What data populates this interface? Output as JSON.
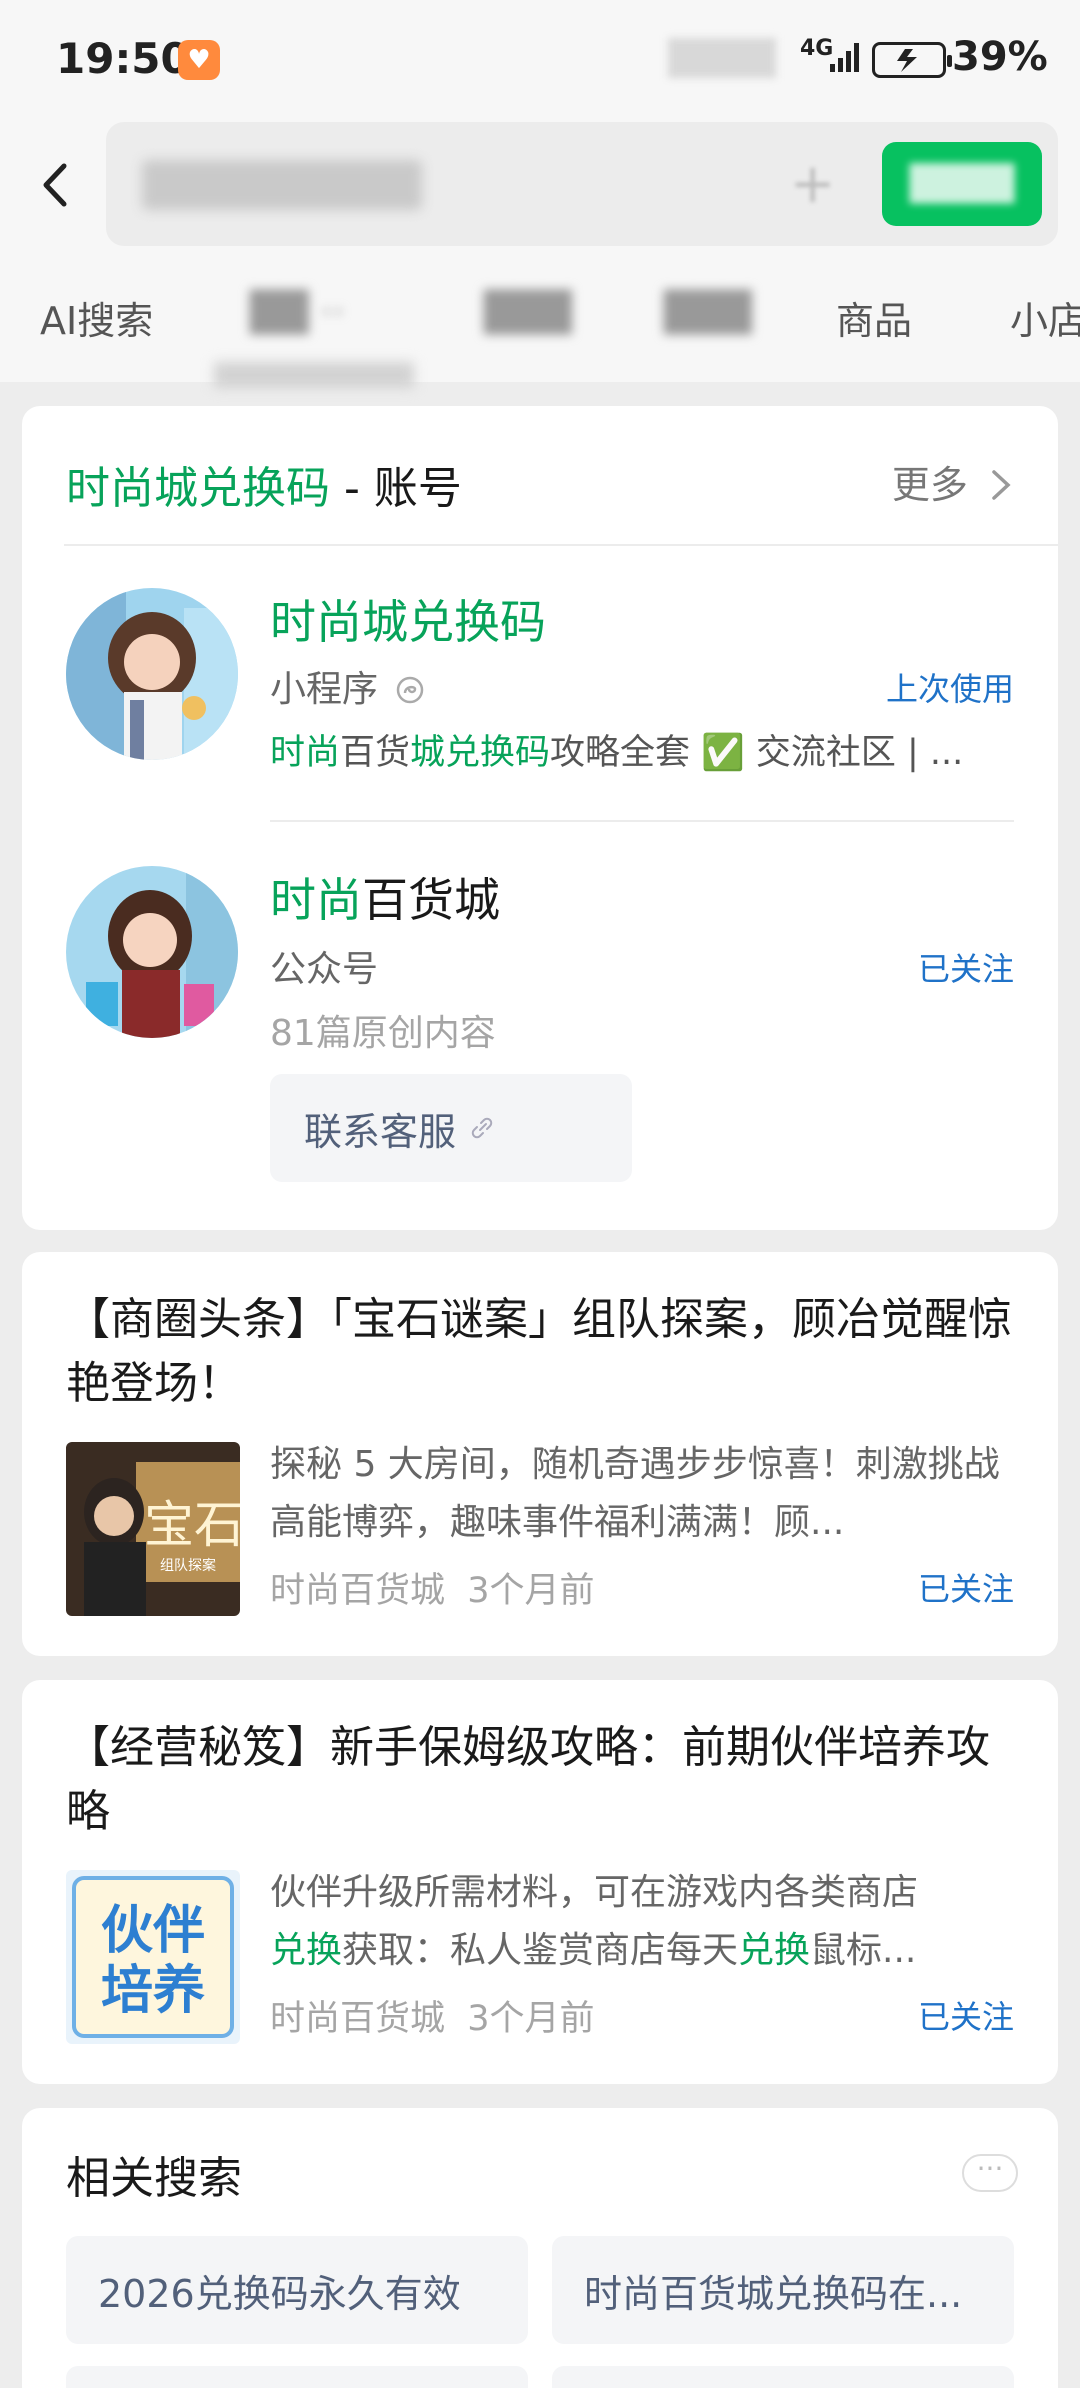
{
  "status_bar": {
    "time": "19:50",
    "network": "4G",
    "battery": "39%"
  },
  "header": {
    "back_icon": "chevron-left-icon",
    "add_icon": "plus-icon"
  },
  "tabs": [
    {
      "label": "AI搜索"
    },
    {
      "label": "商品"
    },
    {
      "label": "小店"
    }
  ],
  "account_card": {
    "title_highlight": "时尚城兑换码",
    "title_suffix": " - 账号",
    "more_label": "更多",
    "items": [
      {
        "name": "时尚城兑换码",
        "type": "小程序",
        "tag": "上次使用",
        "desc_parts": [
          "时尚",
          "百货",
          "城兑换码",
          "攻略全套 ✅ 交流社区 | ..."
        ]
      },
      {
        "name_highlight": "时尚",
        "name_rest": "百货城",
        "type": "公众号",
        "tag": "已关注",
        "stats": "81篇原创内容",
        "service_button": "联系客服"
      }
    ]
  },
  "articles": [
    {
      "title": "【商圈头条】「宝石谜案」组队探案，顾冶觉醒惊艳登场！",
      "desc": "探秘 5 大房间，随机奇遇步步惊喜！刺激挑战高能博弈，趣味事件福利满满！顾...",
      "source": "时尚百货城",
      "time": "3个月前",
      "tag": "已关注",
      "thumb_text": "宝石",
      "thumb_sub": "组队探案"
    },
    {
      "title": "【经营秘笈】新手保姆级攻略：前期伙伴培养攻略",
      "desc_line1": "伙伴升级所需材料，可在游戏内各类商店",
      "desc_line2_parts": [
        "兑换",
        "获取：私人鉴赏商店每天",
        "兑换",
        "鼠标..."
      ],
      "source": "时尚百货城",
      "time": "3个月前",
      "tag": "已关注",
      "thumb_text": "伙伴培养"
    }
  ],
  "related": {
    "title": "相关搜索",
    "more_icon": "ellipsis-icon",
    "items": [
      "2026兑换码永久有效",
      "时尚百货城兑换码在..."
    ]
  }
}
